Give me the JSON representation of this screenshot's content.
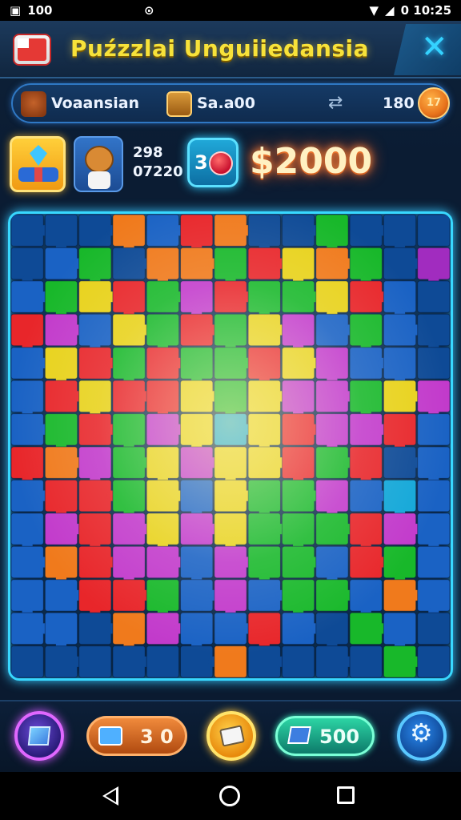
{
  "status_bar": {
    "left_text": "100",
    "right_text": "0 10:25"
  },
  "header": {
    "title": "Puźzzlai Unguiiedansia",
    "close_symbol": "✕",
    "title_color": "#f7e23a"
  },
  "info_bar": {
    "player_label": "Voaansian",
    "score_label": "Sa.a00",
    "arrows_symbol": "⇄",
    "count": "180",
    "coin_text": "17"
  },
  "stats": {
    "line1": "298",
    "line2": "07220",
    "timer_number": "3",
    "score": "$2000"
  },
  "board": {
    "colors": {
      "R": "#e8262a",
      "O": "#f07a1c",
      "Y": "#e8d21a",
      "G": "#18b82a",
      "B": "#1a62c4",
      "D": "#0e4a96",
      "P": "#c23acb",
      "M": "#a12cbf",
      "L": "#12a7d8",
      "K": "#e23c8c"
    },
    "rows": [
      "DDDOBRODDGDDD",
      "DBGDOOGRYOGDM",
      "BGYRGPRGGYRBD",
      "RPBYGRGYPBGBD",
      "BYRGRGGRYPBBD",
      "BRYRRYGYPPGYP",
      "BGRGPYLYRPPRB",
      "ROPGYPYYRGRDB",
      "BRRGYBYGGPBLB",
      "BPRPYPYGGGRPB",
      "BORPPBPGGBRGB",
      "BBRRGBPBGGBOB",
      "BBDOPBBRBDGBD",
      "DDDDDDODDDDGD"
    ]
  },
  "bottom_bar": {
    "left_pill_value": "3 0",
    "right_pill_value": "500",
    "gear_symbol": "⚙"
  },
  "icons": {
    "flag": "flag-icon",
    "close": "close-icon",
    "avatar": "bear-avatar-icon",
    "chest": "chest-icon",
    "arrows": "swap-arrows-icon",
    "coin": "coin-icon",
    "gem": "gem-badge-icon",
    "timer": "timer-icon",
    "map": "map-icon",
    "gift": "gift-icon",
    "gear": "gear-icon"
  }
}
